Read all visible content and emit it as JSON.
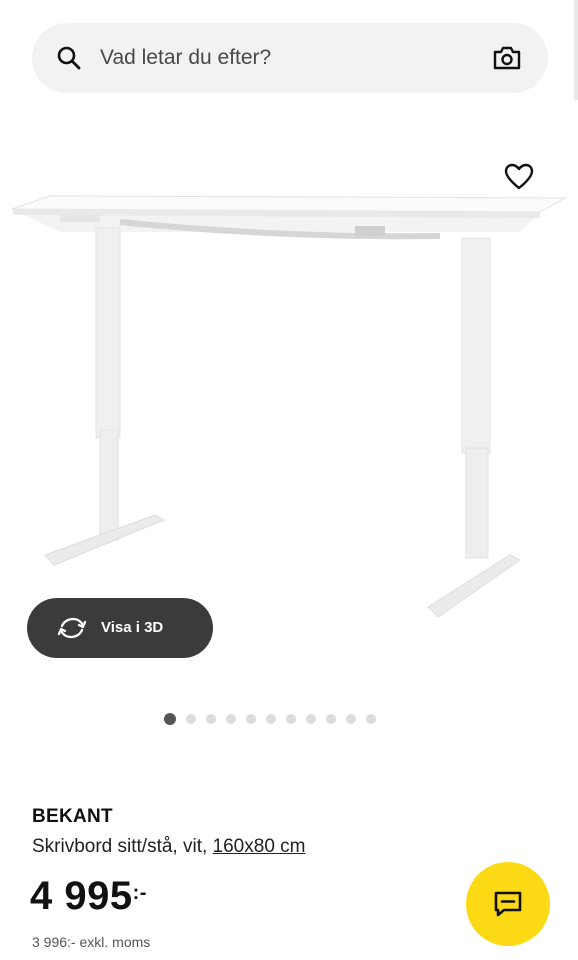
{
  "search": {
    "placeholder": "Vad letar du efter?",
    "icon": "search-icon",
    "camera_icon": "camera-icon"
  },
  "favorite": {
    "icon": "heart-icon"
  },
  "gallery": {
    "view_3d_label": "Visa i 3D",
    "rotate_icon": "rotate-3d-icon",
    "dot_count": 11,
    "active_index": 0
  },
  "product": {
    "name": "BEKANT",
    "description_prefix": "Skrivbord sitt/stå, vit, ",
    "size": "160x80 cm",
    "price_main": "4 995",
    "price_suffix": ":-",
    "price_excl_vat": "3 996:- exkl. moms"
  },
  "chat": {
    "icon": "chat-icon",
    "color": "#fbd914"
  },
  "colors": {
    "search_bg": "#f2f2f2",
    "button_dark": "#3b3b3b",
    "accent_yellow": "#fbd914"
  }
}
